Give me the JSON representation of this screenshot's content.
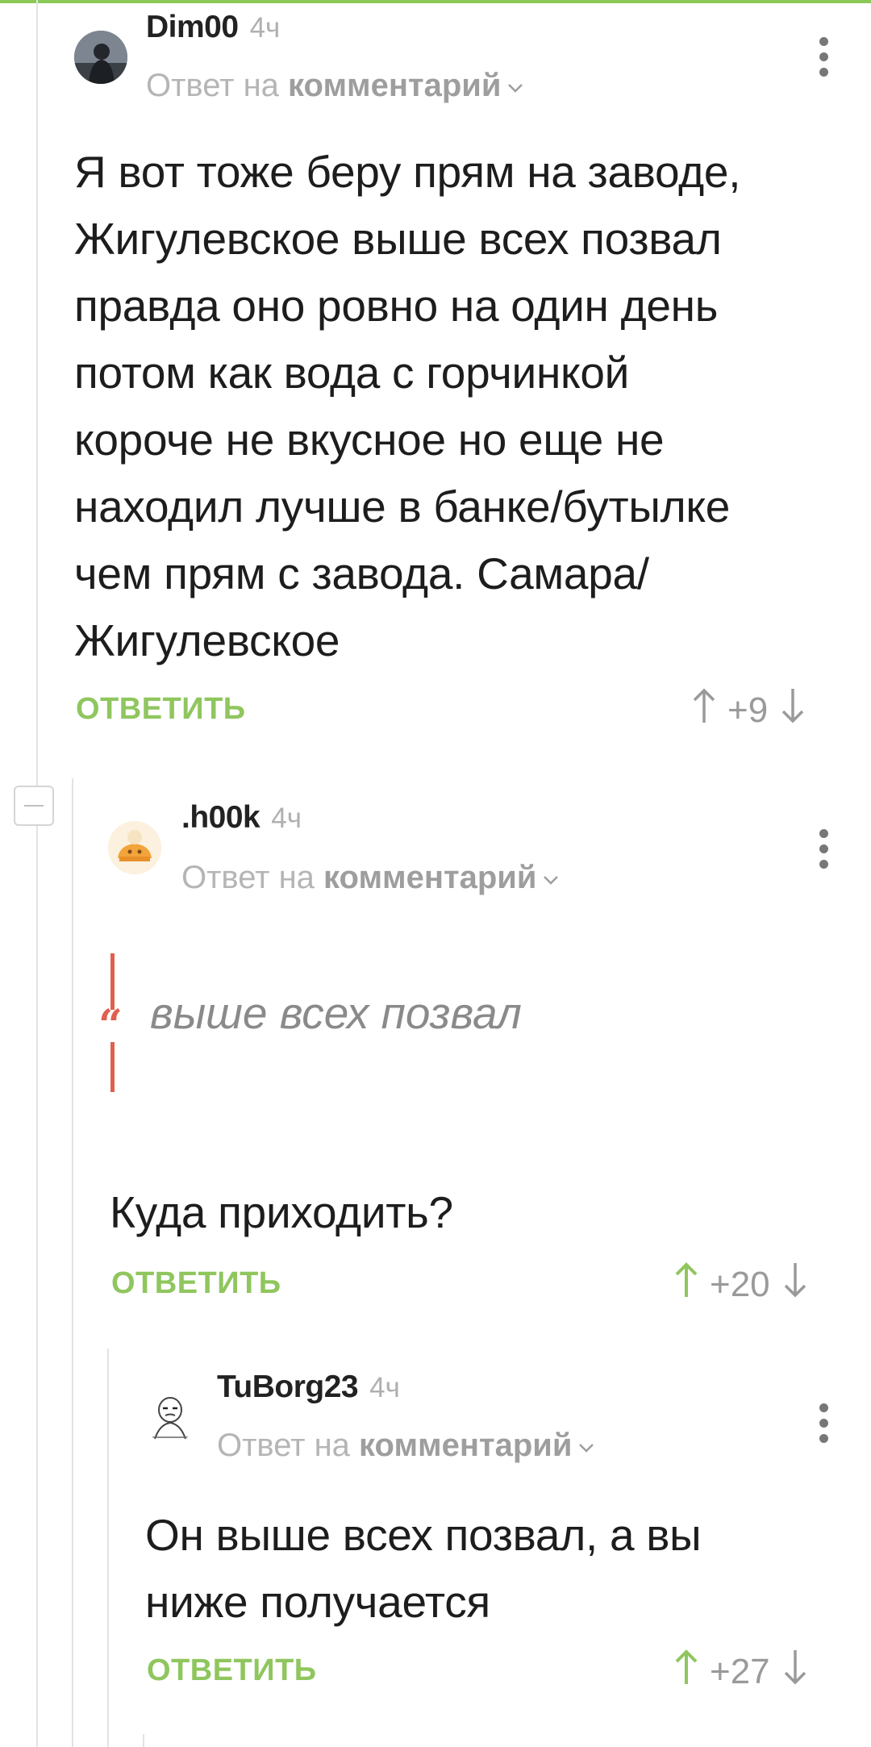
{
  "colors": {
    "accent": "#8fc65e",
    "quote": "#e0604f",
    "muted": "#b0b0b0"
  },
  "comments": [
    {
      "author": "Dim00",
      "time": "4ч",
      "reply_prefix": "Ответ на",
      "reply_link": "комментарий",
      "text": "Я вот тоже беру прям на заводе,\nЖигулевское выше всех позвал\nправда оно ровно на один день\nпотом как вода с горчинкой\nкороче не вкусное но еще не\nнаходил лучше в банке/бутылке\nчем прям с завода. Самара/\nЖигулевское",
      "reply_label": "ОТВЕТИТЬ",
      "score": "+9"
    },
    {
      "author": ".h00k",
      "time": "4ч",
      "reply_prefix": "Ответ на",
      "reply_link": "комментарий",
      "quote": "выше всех позвал",
      "text": "Куда приходить?",
      "reply_label": "ОТВЕТИТЬ",
      "score": "+20"
    },
    {
      "author": "TuBorg23",
      "time": "4ч",
      "reply_prefix": "Ответ на",
      "reply_link": "комментарий",
      "text": "Он выше всех позвал, а вы\nниже получается",
      "reply_label": "ОТВЕТИТЬ",
      "score": "+27"
    }
  ]
}
